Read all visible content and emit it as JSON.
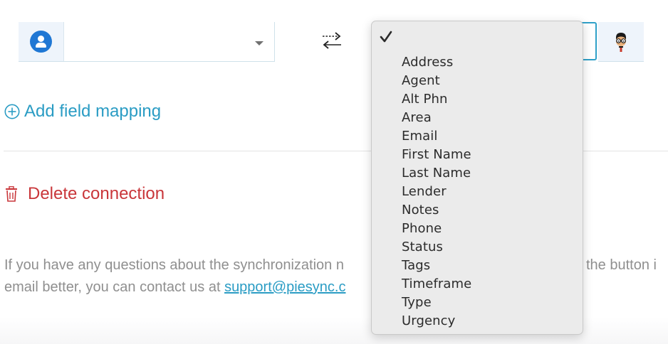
{
  "mapping": {
    "left_field": {
      "value": "",
      "icon": "person-circle-icon"
    },
    "swap_icon": "swap-arrows-icon",
    "right_field": {
      "value": "",
      "icon": "avatar-glasses-icon"
    }
  },
  "actions": {
    "add_field_mapping": "Add field mapping",
    "delete_connection": "Delete connection"
  },
  "help": {
    "line1_left": "If you have any questions about the synchronization ",
    "line1_left_tail": "n",
    "line1_right": "the button i",
    "line2_text": "email better, you can contact us at ",
    "line2_link": "support@piesync.c"
  },
  "dropdown": {
    "selected": "",
    "options": [
      "Address",
      "Agent",
      "Alt Phn",
      "Area",
      "Email",
      "First Name",
      "Last Name",
      "Lender",
      "Notes",
      "Phone",
      "Status",
      "Tags",
      "Timeframe",
      "Type",
      "Urgency"
    ]
  },
  "colors": {
    "accent": "#2a9cc4",
    "danger": "#c9363a",
    "focus_border": "#2fa0c8",
    "icon_blue": "#1f77d4"
  }
}
